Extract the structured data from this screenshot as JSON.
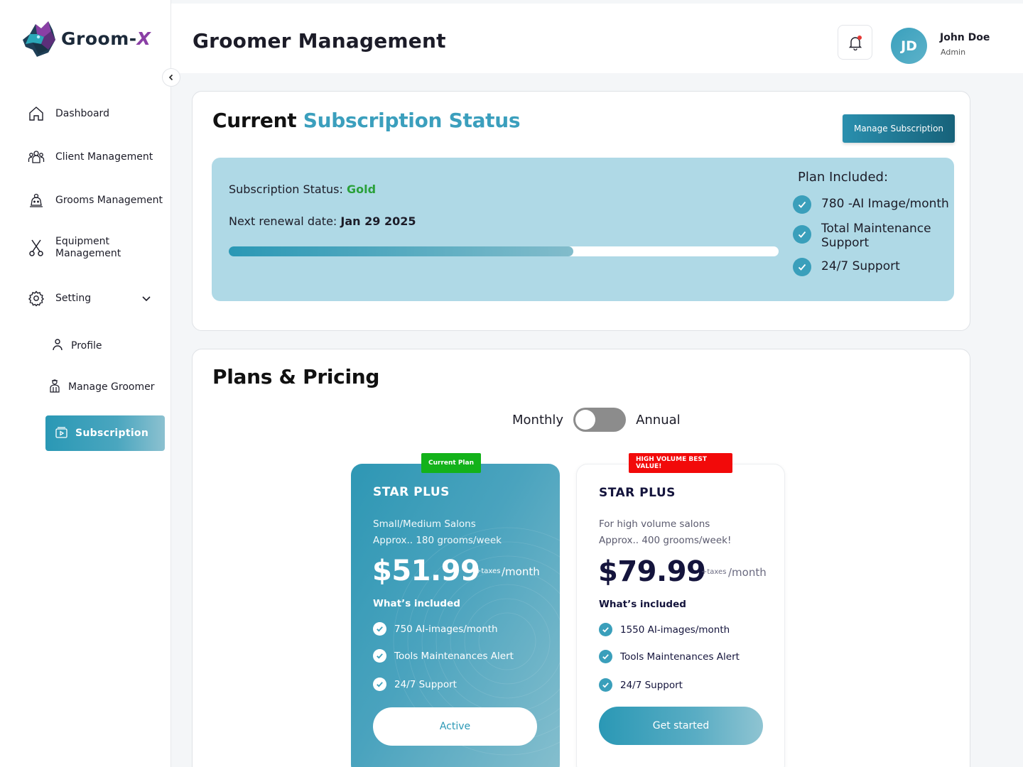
{
  "brand": {
    "name": "Groom-",
    "suffix": "X"
  },
  "sidebar": {
    "items": [
      {
        "label": "Dashboard",
        "icon": "home-icon"
      },
      {
        "label": "Client Management",
        "icon": "users-icon"
      },
      {
        "label": "Grooms Management",
        "icon": "dog-icon"
      },
      {
        "label": "Equipment Management",
        "icon": "scissors-icon"
      },
      {
        "label": "Setting",
        "icon": "gear-icon"
      }
    ],
    "sub_items": [
      {
        "label": "Profile",
        "icon": "person-icon"
      },
      {
        "label": "Manage Groomer",
        "icon": "groomer-icon"
      },
      {
        "label": "Subscription",
        "icon": "subscription-icon",
        "active": true
      }
    ]
  },
  "header": {
    "title": "Groomer Management",
    "user": {
      "initials": "JD",
      "name": "John Doe",
      "role": "Admin"
    }
  },
  "subscription": {
    "title_main": "Current",
    "title_accent": "Subscription Status",
    "manage_label": "Manage Subscription",
    "status_label": "Subscription Status: ",
    "status_value": "Gold",
    "renewal_label": "Next renewal date: ",
    "renewal_value": "Jan 29 2025",
    "progress": 0.626,
    "plan_included_title": "Plan Included:",
    "plan_included": [
      "780 -AI Image/month",
      "Total Maintenance Support",
      "24/7 Support"
    ]
  },
  "plans": {
    "title": "Plans & Pricing",
    "toggle": {
      "left": "Monthly",
      "right": "Annual",
      "annual_selected": false
    },
    "cards": [
      {
        "badge": "Current Plan",
        "badge_color": "#13b21a",
        "name": "STAR PLUS",
        "desc1": "Small/Medium Salons",
        "desc2": "Approx.. 180 grooms/week",
        "price": "$51.99",
        "tax": "+taxes",
        "per": "/month",
        "included_label": "What’s included",
        "features": [
          "750 AI-images/month",
          "Tools Maintenances Alert",
          "24/7 Support"
        ],
        "button": "Active"
      },
      {
        "badge": "HIGH VOLUME BEST VALUE!",
        "badge_color": "#f20a0a",
        "name": "STAR PLUS",
        "desc1": "For high volume salons",
        "desc2": "Approx.. 400 grooms/week!",
        "price": "$79.99",
        "tax": "+taxes",
        "per": "/month",
        "included_label": "What’s included",
        "features": [
          "1550 AI-images/month",
          "Tools Maintenances Alert",
          "24/7 Support"
        ],
        "button": "Get started"
      }
    ]
  },
  "colors": {
    "accent": "#3b9fbd",
    "panel": "#afd9e6",
    "gold": "#2aa13a",
    "dark_button": "#17627a"
  }
}
